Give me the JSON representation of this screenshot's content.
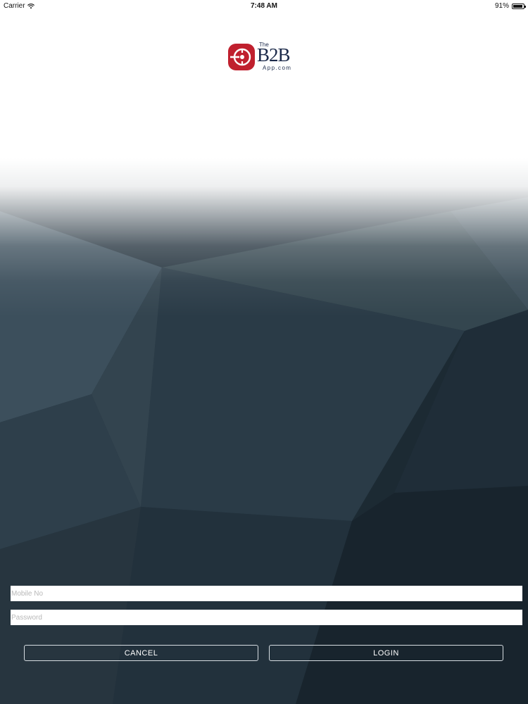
{
  "status_bar": {
    "carrier": "Carrier",
    "time": "7:48 AM",
    "battery_percent": "91%",
    "battery_level": 0.91,
    "wifi_icon": "wifi-icon",
    "battery_icon": "battery-icon"
  },
  "logo": {
    "the": "The",
    "name": "B2B",
    "domain": "App.com",
    "mark_icon": "b2b-logo-mark-icon",
    "brand_red": "#c0202e",
    "brand_navy": "#1c2a4a"
  },
  "form": {
    "mobile": {
      "placeholder": "Mobile No",
      "value": ""
    },
    "password": {
      "placeholder": "Password",
      "value": ""
    },
    "cancel_label": "CANCEL",
    "login_label": "LOGIN"
  },
  "colors": {
    "background_dark": "#1e2b36",
    "input_bg": "#ffffff",
    "button_border": "#d7dde2"
  }
}
